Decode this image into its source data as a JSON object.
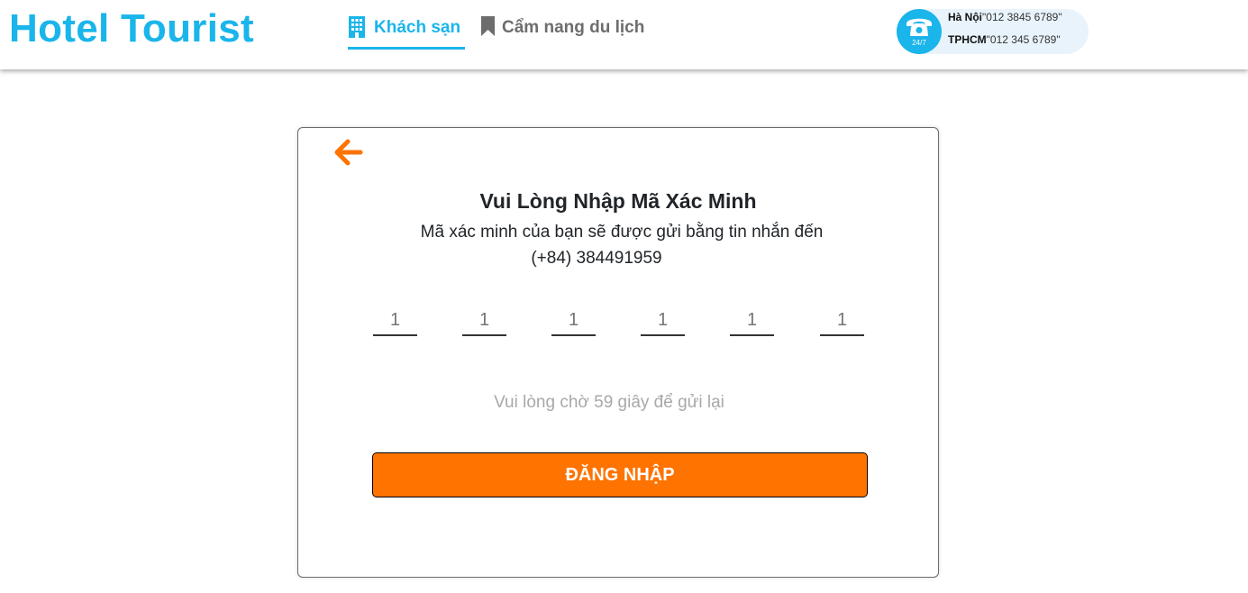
{
  "header": {
    "logo": "Hotel Tourist",
    "nav": [
      {
        "label": "Khách sạn",
        "icon": "building-icon",
        "active": true
      },
      {
        "label": "Cẩm nang du lịch",
        "icon": "bookmark-icon",
        "active": false
      }
    ],
    "hotline": {
      "badge": "24/7",
      "icon": "phone-icon",
      "lines": [
        {
          "city": "Hà Nội",
          "number": "\"012 3845 6789\""
        },
        {
          "city": "TPHCM",
          "number": "\"012 345 6789\""
        }
      ]
    }
  },
  "verify": {
    "back_icon": "arrow-left-icon",
    "title": "Vui Lòng Nhập Mã Xác Minh",
    "subtitle": "Mã xác minh của bạn sẽ được gửi bằng tin nhắn đến",
    "phone": "(+84) 384491959",
    "code_placeholders": [
      "1",
      "1",
      "1",
      "1",
      "1",
      "1"
    ],
    "resend_text": "Vui lòng chờ 59 giây để gửi lại",
    "submit_label": "ĐĂNG NHẬP"
  },
  "colors": {
    "brand": "#1ab5ea",
    "accent": "#ff7300",
    "muted": "#a8a8a8",
    "hotline_bg": "#e8f3fc"
  }
}
